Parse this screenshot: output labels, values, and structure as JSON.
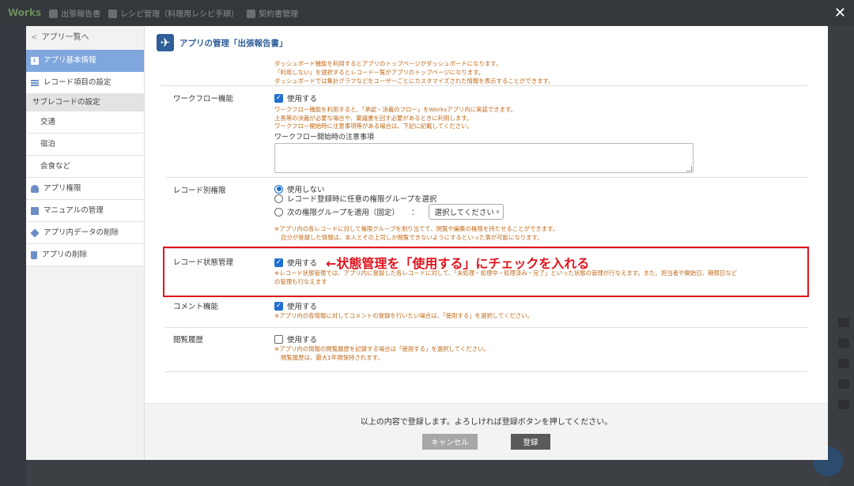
{
  "background": {
    "brand": "Works",
    "tabs": [
      "出張報告書",
      "レシピ管理（料理用レシピ手順）",
      "契約書管理"
    ]
  },
  "sidebar": {
    "back_label": "アプリ一覧へ",
    "items": [
      {
        "label": "アプリ基本情報",
        "icon": "info-icon",
        "active": true
      },
      {
        "label": "レコード項目の設定",
        "icon": "list-icon"
      },
      {
        "label": "サブレコードの設定",
        "section": true
      },
      {
        "label": "交通",
        "sub": true
      },
      {
        "label": "宿泊",
        "sub": true
      },
      {
        "label": "会食など",
        "sub": true
      },
      {
        "label": "アプリ権限",
        "icon": "users-icon"
      },
      {
        "label": "マニュアルの管理",
        "icon": "book-icon"
      },
      {
        "label": "アプリ内データの削除",
        "icon": "eraser-icon"
      },
      {
        "label": "アプリの削除",
        "icon": "trash-icon"
      }
    ]
  },
  "header": {
    "title": "アプリの管理「出張報告書」"
  },
  "top_notes": [
    "ダッシュボード機能を利用するとアプリのトップページがダッシュボードになります。",
    "「利用しない」を選択するとレコード一覧がアプリのトップページになります。",
    "ダッシュボードでは集計グラフなどをユーザーごとにカスタマイズされた情報を表示することができます。"
  ],
  "workflow": {
    "label": "ワークフロー機能",
    "checkbox_label": "使用する",
    "checked": true,
    "notes": [
      "ワークフロー機能を利用すると、「承認・決裁のフロー」をWorksアプリ内に実装できます。",
      "上長等の決裁が必要な場合や、稟議書を回す必要があるときに利用します。",
      "ワークフロー開始時に注意事項等がある場合は、下記に記載してください。"
    ],
    "caution_label": "ワークフロー開始時の注意事項"
  },
  "permission": {
    "label": "レコード別権限",
    "options": [
      {
        "label": "使用しない",
        "selected": true
      },
      {
        "label": "レコード登録時に任意の権限グループを選択",
        "selected": false
      },
      {
        "label": "次の権限グループを適用（固定）",
        "selected": false
      }
    ],
    "colon": "：",
    "select_value": "選択してください",
    "notes": [
      "※アプリ内の各レコードに対して権限グループを割り当てて、閲覧や編集の権限を持たせることができます。",
      "自分が登録した情報は、本人とその上司しか閲覧できないようにするといった事が可能になります。"
    ]
  },
  "status": {
    "label": "レコード状態管理",
    "checkbox_label": "使用する",
    "checked": true,
    "annotation": "←状態管理を「使用する」にチェックを入れる",
    "notes": [
      "※レコード状態管理では、アプリ内に登録した各レコードに対して、「未処理・処理中・処理済み・完了」といった状態の管理が行なえます。また、担当者や開始日、期限日など",
      "の管理も行なえます"
    ],
    "highlight_color": "#e0141e"
  },
  "comment": {
    "label": "コメント機能",
    "checkbox_label": "使用する",
    "checked": true,
    "notes": [
      "※アプリ内の各情報に対してコメントの登録を行いたい場合は、「使用する」を選択してください。"
    ]
  },
  "history": {
    "label": "閲覧履歴",
    "checkbox_label": "使用する",
    "checked": false,
    "notes": [
      "※アプリ内の情報の閲覧履歴を記録する場合は「使用する」を選択してください。",
      "閲覧履歴は、最大1年間保持されます。"
    ]
  },
  "footer": {
    "message": "以上の内容で登録します。よろしければ登録ボタンを押してください。",
    "cancel_label": "キャンセル",
    "save_label": "登録"
  },
  "close_glyph": "✕",
  "colors": {
    "accent": "#2f5e99",
    "active_nav": "#7fa7dd",
    "note_text": "#c06a1a",
    "annotation": "#e0141e"
  }
}
